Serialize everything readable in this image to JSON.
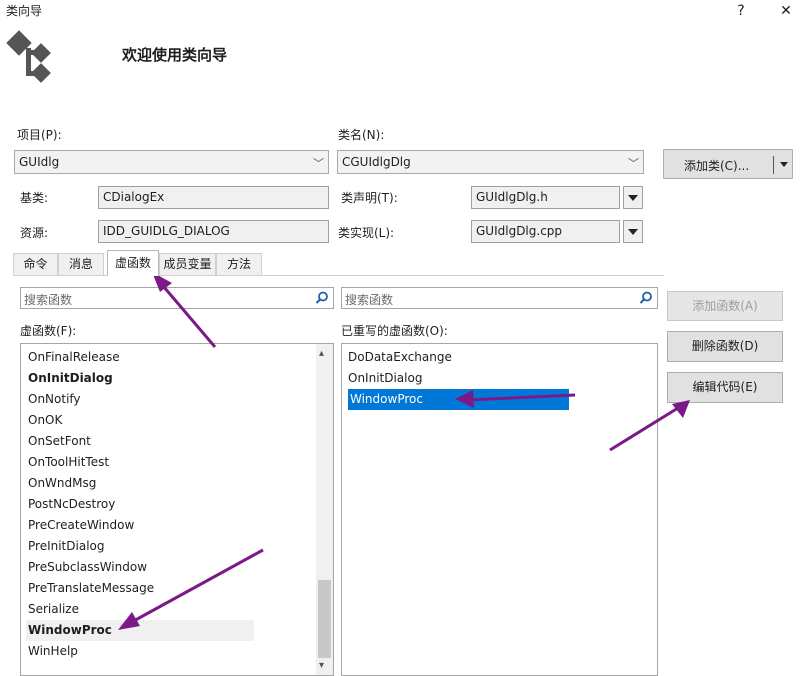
{
  "window": {
    "title": "类向导",
    "help": "?",
    "close": "✕",
    "header_title": "欢迎使用类向导"
  },
  "form": {
    "project_label": "项目(P):",
    "project_value": "GUIdlg",
    "classname_label": "类名(N):",
    "classname_value": "CGUIdlgDlg",
    "add_class_label": "添加类(C)...",
    "base_label": "基类:",
    "base_value": "CDialogEx",
    "decl_label": "类声明(T):",
    "decl_value": "GUIdlgDlg.h",
    "resource_label": "资源:",
    "resource_value": "IDD_GUIDLG_DIALOG",
    "impl_label": "类实现(L):",
    "impl_value": "GUIdlgDlg.cpp"
  },
  "tabs": [
    {
      "label": "命令"
    },
    {
      "label": "消息"
    },
    {
      "label": "虚函数"
    },
    {
      "label": "成员变量"
    },
    {
      "label": "方法"
    }
  ],
  "virtual_tab": {
    "search_left_placeholder": "搜索函数",
    "search_right_placeholder": "搜索函数",
    "left_list_label": "虚函数(F):",
    "right_list_label": "已重写的虚函数(O):",
    "left_items": [
      "OnFinalRelease",
      "OnInitDialog",
      "OnNotify",
      "OnOK",
      "OnSetFont",
      "OnToolHitTest",
      "OnWndMsg",
      "PostNcDestroy",
      "PreCreateWindow",
      "PreInitDialog",
      "PreSubclassWindow",
      "PreTranslateMessage",
      "Serialize",
      "WindowProc",
      "WinHelp"
    ],
    "right_items": [
      "DoDataExchange",
      "OnInitDialog",
      "WindowProc"
    ],
    "add_function_label": "添加函数(A)",
    "delete_function_label": "删除函数(D)",
    "edit_code_label": "编辑代码(E)"
  },
  "colors": {
    "selection": "#0078d7",
    "annotation_arrow": "#7b1a86"
  }
}
